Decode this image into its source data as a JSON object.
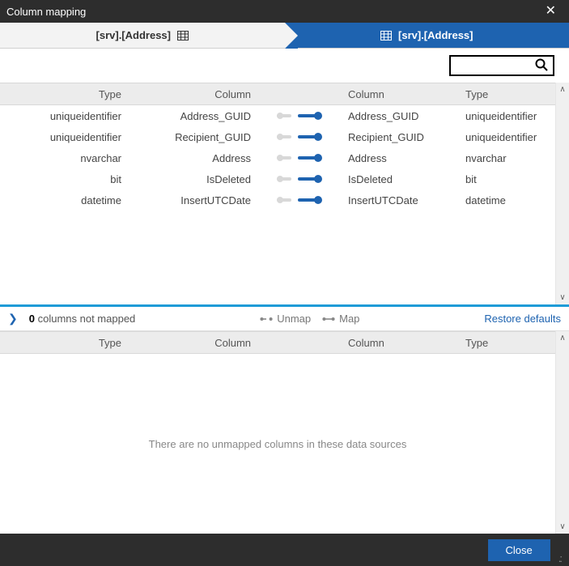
{
  "window": {
    "title": "Column mapping"
  },
  "tabs": {
    "left_label": "[srv].[Address]",
    "right_label": "[srv].[Address]"
  },
  "search": {
    "value": ""
  },
  "headers": {
    "type": "Type",
    "column": "Column"
  },
  "rows": [
    {
      "src_type": "uniqueidentifier",
      "src_col": "Address_GUID",
      "dst_col": "Address_GUID",
      "dst_type": "uniqueidentifier"
    },
    {
      "src_type": "uniqueidentifier",
      "src_col": "Recipient_GUID",
      "dst_col": "Recipient_GUID",
      "dst_type": "uniqueidentifier"
    },
    {
      "src_type": "nvarchar",
      "src_col": "Address",
      "dst_col": "Address",
      "dst_type": "nvarchar"
    },
    {
      "src_type": "bit",
      "src_col": "IsDeleted",
      "dst_col": "IsDeleted",
      "dst_type": "bit"
    },
    {
      "src_type": "datetime",
      "src_col": "InsertUTCDate",
      "dst_col": "InsertUTCDate",
      "dst_type": "datetime"
    }
  ],
  "midbar": {
    "count": "0",
    "status_label": "columns not mapped",
    "unmap": "Unmap",
    "map": "Map",
    "restore": "Restore defaults"
  },
  "bottom_headers": {
    "type": "Type",
    "column": "Column"
  },
  "empty_message": "There are no unmapped columns in these data sources",
  "footer": {
    "close": "Close"
  }
}
